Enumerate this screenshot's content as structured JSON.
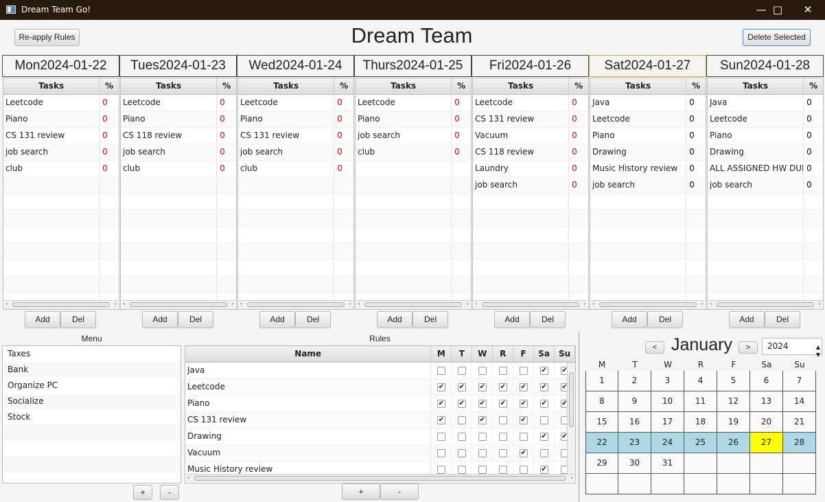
{
  "window": {
    "title": "Dream Team Go!",
    "min_glyph": "—",
    "max_glyph": "□",
    "close_glyph": "✕"
  },
  "toolbar": {
    "reapply_label": "Re-apply Rules",
    "heading": "Dream Team",
    "delete_label": "Delete Selected"
  },
  "days": [
    {
      "header": "Mon2024-01-22",
      "tasks": [
        [
          "Leetcode",
          "0"
        ],
        [
          "Piano",
          "0"
        ],
        [
          "CS 131 review",
          "0"
        ],
        [
          "job search",
          "0"
        ],
        [
          "club",
          "0"
        ]
      ],
      "pct_color": "#e00000"
    },
    {
      "header": "Tues2024-01-23",
      "tasks": [
        [
          "Leetcode",
          "0"
        ],
        [
          "Piano",
          "0"
        ],
        [
          "CS 118 review",
          "0"
        ],
        [
          "job search",
          "0"
        ],
        [
          "club",
          "0"
        ]
      ],
      "pct_color": "#e00000"
    },
    {
      "header": "Wed2024-01-24",
      "tasks": [
        [
          "Leetcode",
          "0"
        ],
        [
          "Piano",
          "0"
        ],
        [
          "CS 131 review",
          "0"
        ],
        [
          "job search",
          "0"
        ],
        [
          "club",
          "0"
        ]
      ],
      "pct_color": "#e00000"
    },
    {
      "header": "Thurs2024-01-25",
      "tasks": [
        [
          "Leetcode",
          "0"
        ],
        [
          "Piano",
          "0"
        ],
        [
          "job search",
          "0"
        ],
        [
          "club",
          "0"
        ]
      ],
      "pct_color": "#e00000"
    },
    {
      "header": "Fri2024-01-26",
      "tasks": [
        [
          "Leetcode",
          "0"
        ],
        [
          "CS 131 review",
          "0"
        ],
        [
          "Vacuum",
          "0"
        ],
        [
          "CS 118 review",
          "0"
        ],
        [
          "Laundry",
          "0"
        ],
        [
          "job search",
          "0"
        ]
      ],
      "pct_color": "#e00000"
    },
    {
      "header": "Sat2024-01-27",
      "tasks": [
        [
          "Java",
          "0"
        ],
        [
          "Leetcode",
          "0"
        ],
        [
          "Piano",
          "0"
        ],
        [
          "Drawing",
          "0"
        ],
        [
          "Music History review",
          "0"
        ],
        [
          "job search",
          "0"
        ]
      ],
      "pct_color": "#111111"
    },
    {
      "header": "Sun2024-01-28",
      "tasks": [
        [
          "Java",
          "0"
        ],
        [
          "Leetcode",
          "0"
        ],
        [
          "Piano",
          "0"
        ],
        [
          "Drawing",
          "0"
        ],
        [
          "ALL ASSIGNED HW DUE",
          "0"
        ],
        [
          "job search",
          "0"
        ]
      ],
      "pct_color": "#111111"
    }
  ],
  "day_columns": {
    "tasks": "Tasks",
    "pct": "%"
  },
  "day_buttons": {
    "add": "Add",
    "del": "Del"
  },
  "menu": {
    "title": "Menu",
    "items": [
      "Taxes",
      "Bank",
      "Organize PC",
      "Socialize",
      "Stock"
    ],
    "add": "+",
    "remove": "-"
  },
  "rules": {
    "title": "Rules",
    "columns": [
      "Name",
      "M",
      "T",
      "W",
      "R",
      "F",
      "Sa",
      "Su"
    ],
    "rows": [
      {
        "name": "Java",
        "checks": [
          false,
          false,
          false,
          false,
          false,
          true,
          true
        ]
      },
      {
        "name": "Leetcode",
        "checks": [
          true,
          true,
          true,
          true,
          true,
          true,
          true
        ]
      },
      {
        "name": "Piano",
        "checks": [
          true,
          true,
          true,
          true,
          true,
          true,
          true
        ]
      },
      {
        "name": "CS 131 review",
        "checks": [
          true,
          false,
          true,
          false,
          true,
          false,
          false
        ]
      },
      {
        "name": "Drawing",
        "checks": [
          false,
          false,
          false,
          false,
          false,
          true,
          true
        ]
      },
      {
        "name": "Vacuum",
        "checks": [
          false,
          false,
          false,
          false,
          true,
          false,
          false
        ]
      },
      {
        "name": "Music History review",
        "checks": [
          false,
          false,
          false,
          false,
          false,
          true,
          false
        ]
      }
    ],
    "add": "+",
    "remove": "-"
  },
  "calendar": {
    "month": "January",
    "year": "2024",
    "prev": "<",
    "next": ">",
    "weekdays": [
      "M",
      "T",
      "W",
      "R",
      "F",
      "Sa",
      "Su"
    ],
    "weeks": [
      [
        "1",
        "2",
        "3",
        "4",
        "5",
        "6",
        "7"
      ],
      [
        "8",
        "9",
        "10",
        "11",
        "12",
        "13",
        "14"
      ],
      [
        "15",
        "16",
        "17",
        "18",
        "19",
        "20",
        "21"
      ],
      [
        "22",
        "23",
        "24",
        "25",
        "26",
        "27",
        "28"
      ],
      [
        "29",
        "30",
        "31",
        "",
        "",
        "",
        ""
      ],
      [
        "",
        "",
        "",
        "",
        "",
        "",
        ""
      ]
    ],
    "highlight_week": 3,
    "today": "27",
    "colors": {
      "week": "#add8e6",
      "today": "#ffff00"
    }
  }
}
